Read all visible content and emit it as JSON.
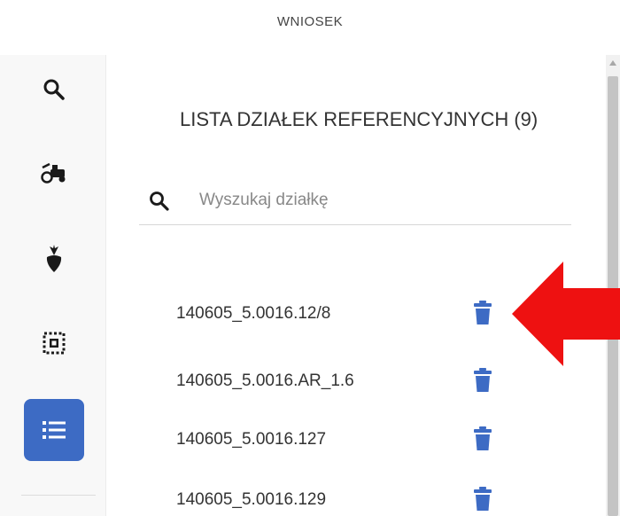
{
  "header": {
    "title": "WNIOSEK"
  },
  "sidebar": {
    "items": [
      {
        "icon": "search-icon",
        "active": false
      },
      {
        "icon": "tractor-icon",
        "active": false
      },
      {
        "icon": "beet-icon",
        "active": false
      },
      {
        "icon": "parcel-selection-icon",
        "active": false
      },
      {
        "icon": "list-icon",
        "active": true
      }
    ]
  },
  "main": {
    "list_title": "LISTA DZIAŁEK REFERENCYJNYCH (9)",
    "search": {
      "placeholder": "Wyszukaj działkę",
      "value": ""
    },
    "parcels": [
      {
        "name": "140605_5.0016.12/8"
      },
      {
        "name": "140605_5.0016.AR_1.6"
      },
      {
        "name": "140605_5.0016.127"
      },
      {
        "name": "140605_5.0016.129"
      }
    ]
  },
  "colors": {
    "accent": "#3d6bc4",
    "trash": "#3d6bc4",
    "arrow": "#ee1111",
    "icon_dark": "#1a1a1a"
  }
}
